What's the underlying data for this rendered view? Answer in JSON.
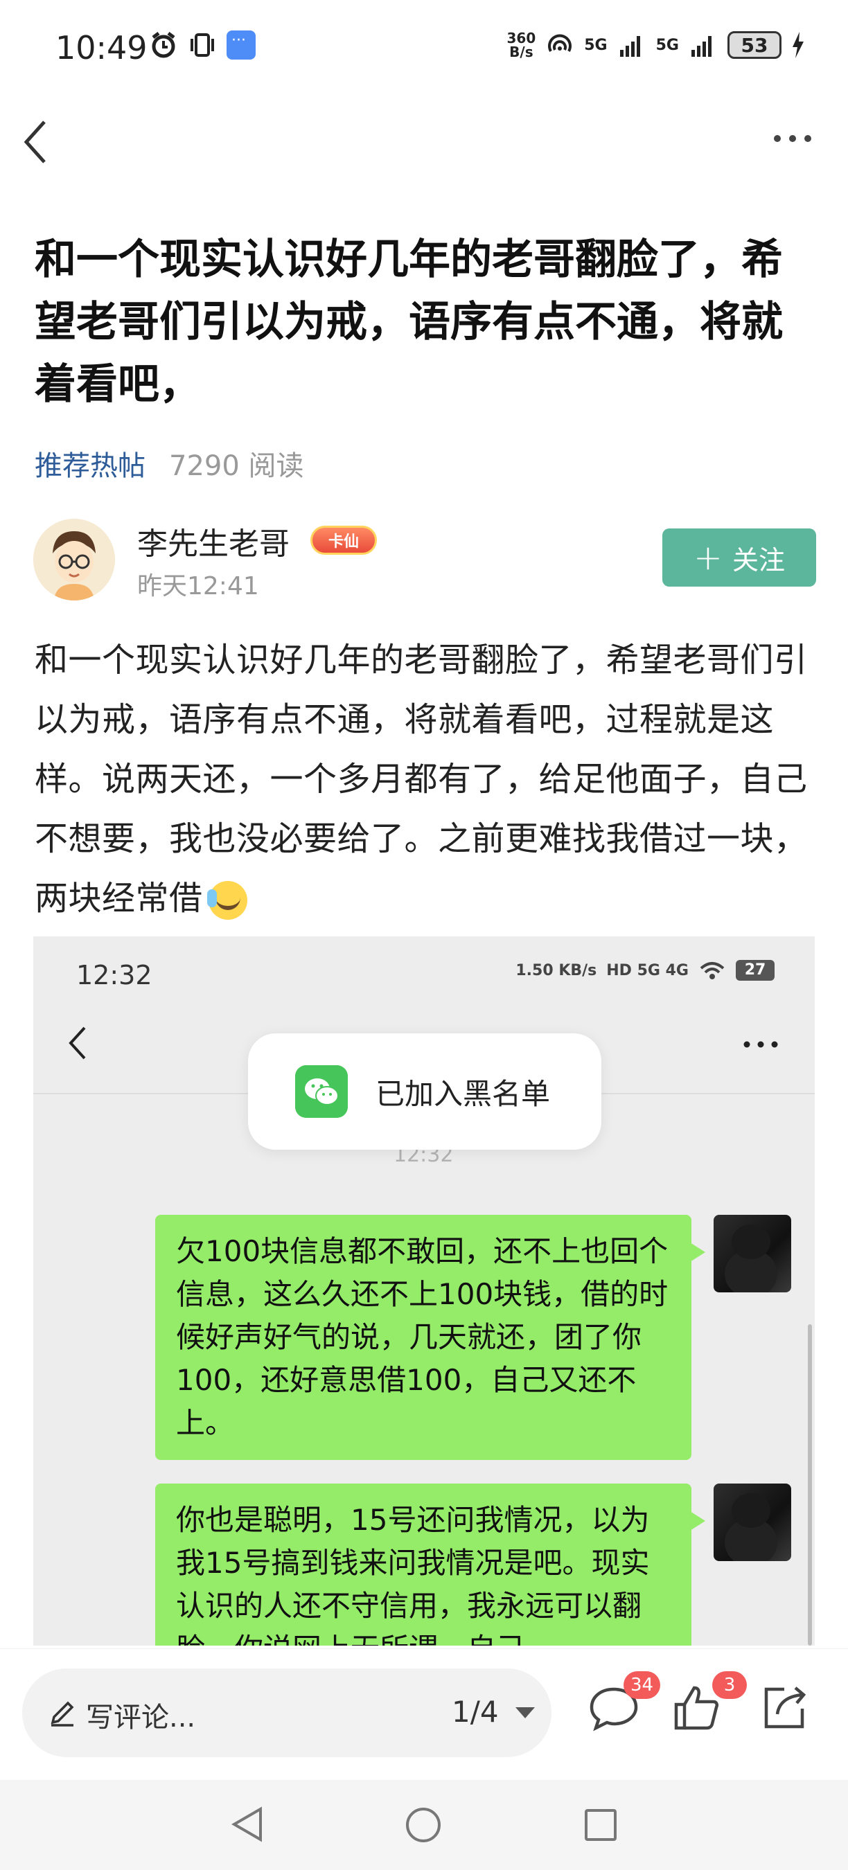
{
  "status_bar": {
    "time": "10:49",
    "net_speed_value": "360",
    "net_speed_unit": "B/s",
    "signal1": "5G",
    "signal2": "5G",
    "battery": "53"
  },
  "post": {
    "title": "和一个现实认识好几年的老哥翻脸了，希望老哥们引以为戒，语序有点不通，将就着看吧，",
    "tag": "推荐热帖",
    "reads": "7290 阅读",
    "author": {
      "name": "李先生老哥",
      "badge": "卡仙",
      "time": "昨天12:41",
      "follow_label": "关注"
    },
    "body": "和一个现实认识好几年的老哥翻脸了，希望老哥们引以为戒，语序有点不通，将就着看吧，过程就是这样。说两天还，一个多月都有了，给足他面子，自己不想要，我也没必要给了。之前更难找我借过一块，两块经常借"
  },
  "screenshot": {
    "time": "12:32",
    "net_speed": "1.50 KB/s",
    "signal": "HD 5G 4G",
    "battery": "27",
    "toast": "已加入黑名单",
    "timestamp": "12:32",
    "messages": [
      "欠100块信息都不敢回，还不上也回个信息，这么久还不上100块钱，借的时候好声好气的说，几天就还，团了你100，还好意思借100，自己又还不上。",
      "你也是聪明，15号还问我情况，以为我15号搞到钱来问我情况是吧。现实认识的人还不守信用，我永远可以翻脸，你说网上无所谓，自己"
    ]
  },
  "action_bar": {
    "comment_placeholder": "写评论...",
    "page_indicator": "1/4",
    "comment_count": "34",
    "like_count": "3"
  },
  "colors": {
    "follow_button": "#5cb69b",
    "tag_link": "#2e5c99",
    "bubble": "#95ec69",
    "badge_red": "#f35b5b"
  }
}
